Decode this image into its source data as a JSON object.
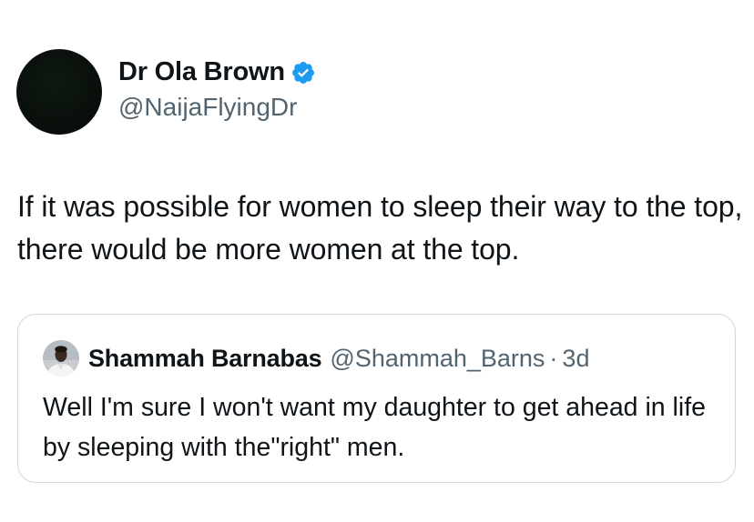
{
  "tweet": {
    "author": {
      "display_name": "Dr Ola Brown",
      "handle": "@NaijaFlyingDr",
      "verified": true
    },
    "text": "If it was possible for women to sleep their way to the top, there would be more women at the top."
  },
  "quoted_tweet": {
    "author": {
      "display_name": "Shammah Barnabas",
      "handle": "@Shammah_Barns"
    },
    "separator": "·",
    "time": "3d",
    "text": "Well I'm sure I won't want my daughter to get ahead in life by sleeping with the\"right\" men."
  },
  "colors": {
    "verified": "#1d9bf0",
    "secondary_text": "#536471",
    "border": "#cfd9de"
  },
  "icons": {
    "verified": "verified-badge-icon"
  }
}
